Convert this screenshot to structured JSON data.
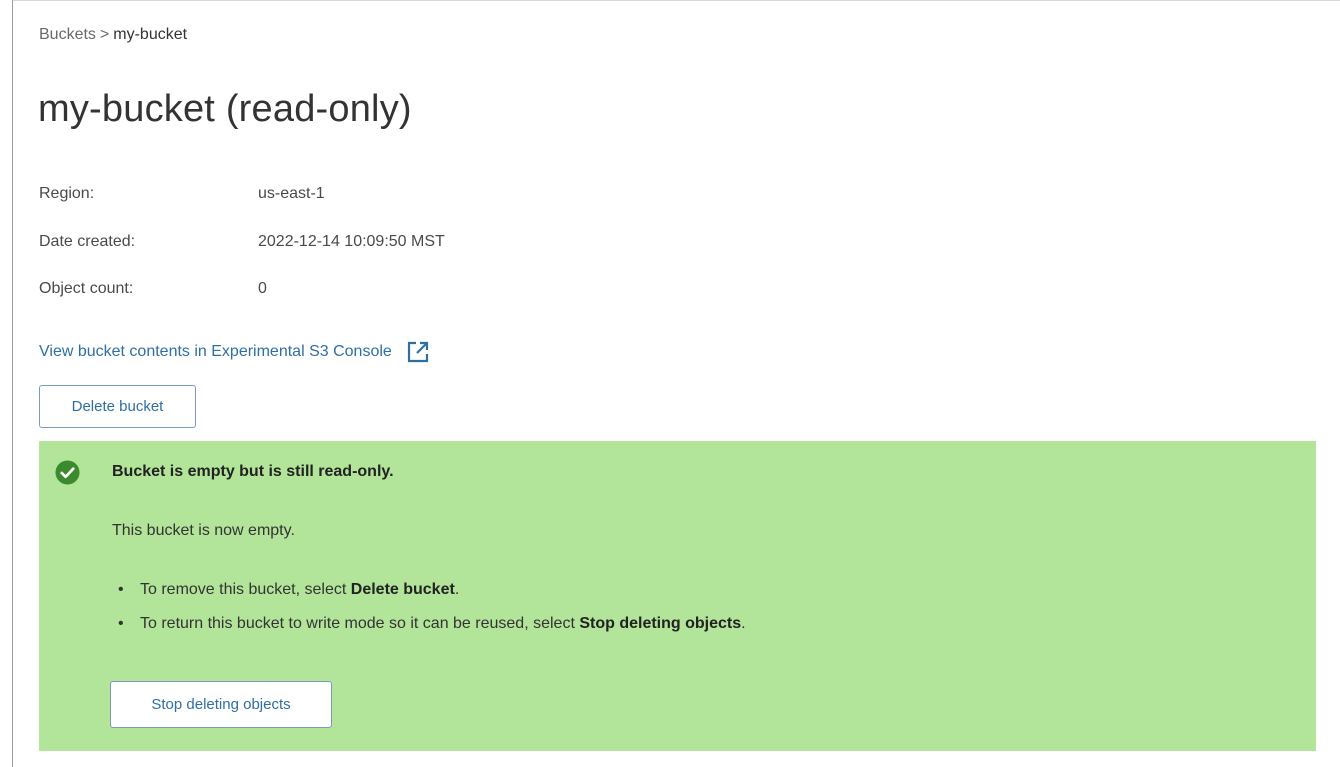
{
  "breadcrumb": {
    "parent": "Buckets",
    "separator": ">",
    "current": "my-bucket"
  },
  "page_title": "my-bucket (read-only)",
  "details": [
    {
      "label": "Region:",
      "value": "us-east-1"
    },
    {
      "label": "Date created:",
      "value": "2022-12-14 10:09:50 MST"
    },
    {
      "label": "Object count:",
      "value": "0"
    }
  ],
  "console_link": {
    "text": "View bucket contents in Experimental S3 Console",
    "icon": "external-link-icon"
  },
  "delete_button_label": "Delete bucket",
  "alert": {
    "icon": "check-circle-icon",
    "title": "Bucket is empty but is still read-only.",
    "body": "This bucket is now empty.",
    "items": [
      {
        "prefix": "To remove this bucket, select ",
        "emphasis": "Delete bucket",
        "suffix": "."
      },
      {
        "prefix": "To return this bucket to write mode so it can be reused, select ",
        "emphasis": "Stop deleting objects",
        "suffix": "."
      }
    ],
    "button_label": "Stop deleting objects"
  },
  "colors": {
    "alert_background": "#b2e59a",
    "success_icon": "#3b8a2e",
    "link": "#2f6fa6",
    "button_border": "#7a9bbd"
  }
}
